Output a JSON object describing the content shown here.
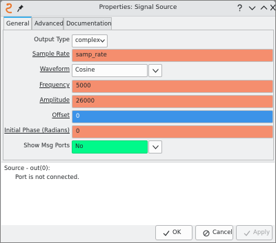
{
  "window": {
    "title": "Properties: Signal Source"
  },
  "tabs": [
    {
      "label": "General",
      "active": true
    },
    {
      "label": "Advanced",
      "active": false
    },
    {
      "label": "Documentation",
      "active": false
    }
  ],
  "params": {
    "output_type": {
      "label": "Output Type",
      "value": "complex"
    },
    "sample_rate": {
      "label": "Sample Rate",
      "value": "samp_rate",
      "color": "#f58e6e"
    },
    "waveform": {
      "label": "Waveform",
      "value": "Cosine"
    },
    "frequency": {
      "label": "Frequency",
      "value": "5000",
      "color": "#f58e6e"
    },
    "amplitude": {
      "label": "Amplitude",
      "value": "26000",
      "color": "#f58e6e"
    },
    "offset": {
      "label": "Offset",
      "value": "0",
      "color": "#3c93e8"
    },
    "initial_phase": {
      "label": "Initial Phase (Radians)",
      "value": "0",
      "color": "#f58e6e"
    },
    "show_msg_ports": {
      "label": "Show Msg Ports",
      "value": "No",
      "color": "#00f98a"
    }
  },
  "log": {
    "line1": "Source - out(0):",
    "line2": "Port is not connected."
  },
  "buttons": {
    "ok": "OK",
    "cancel": "Cancel",
    "apply": "Apply"
  }
}
